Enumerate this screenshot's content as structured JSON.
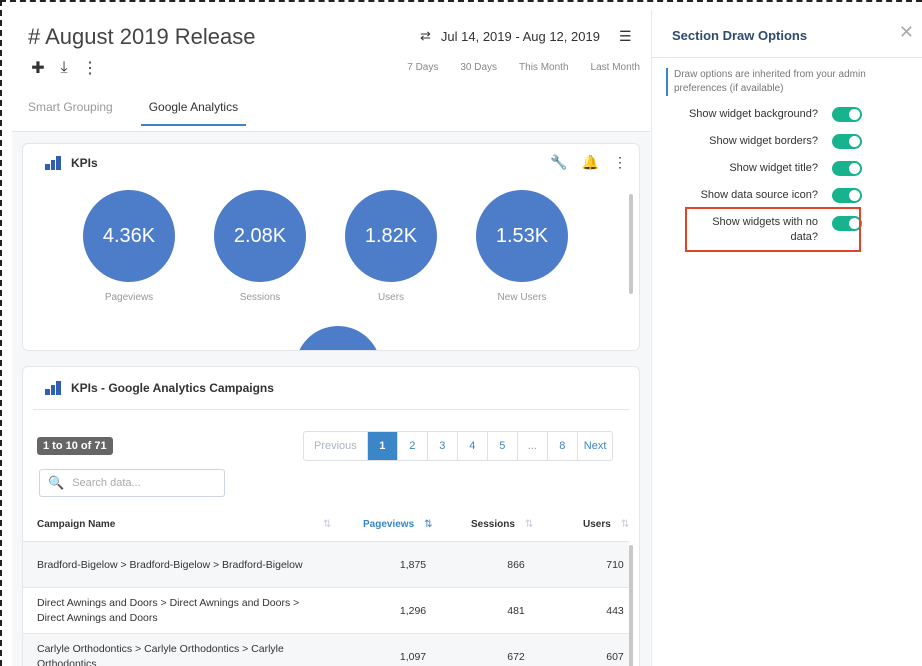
{
  "header": {
    "title": "# August 2019 Release",
    "date_range": "Jul 14, 2019 - Aug 12, 2019",
    "presets": [
      "7 Days",
      "30 Days",
      "This Month",
      "Last Month"
    ],
    "toolbar_icons": [
      "plus-icon",
      "download-icon",
      "more-vertical-icon"
    ]
  },
  "tabs": [
    {
      "label": "Smart Grouping",
      "active": false
    },
    {
      "label": "Google Analytics",
      "active": true
    }
  ],
  "kpi_card": {
    "title": "KPIs",
    "metrics": [
      {
        "value": "4.36K",
        "label": "Pageviews"
      },
      {
        "value": "2.08K",
        "label": "Sessions"
      },
      {
        "value": "1.82K",
        "label": "Users"
      },
      {
        "value": "1.53K",
        "label": "New Users"
      }
    ]
  },
  "campaign_card": {
    "title": "KPIs - Google Analytics Campaigns",
    "count": "1 to 10 of 71",
    "pager": [
      "Previous",
      "1",
      "2",
      "3",
      "4",
      "5",
      "...",
      "8",
      "Next"
    ],
    "search_placeholder": "Search data...",
    "columns": [
      "Campaign Name",
      "Pageviews",
      "Sessions",
      "Users"
    ],
    "rows": [
      {
        "name": "Bradford-Bigelow > Bradford-Bigelow > Bradford-Bigelow",
        "pageviews": "1,875",
        "sessions": "866",
        "users": "710"
      },
      {
        "name": "Direct Awnings and Doors > Direct Awnings and Doors > Direct Awnings and Doors",
        "pageviews": "1,296",
        "sessions": "481",
        "users": "443"
      },
      {
        "name": "Carlyle Orthodontics > Carlyle Orthodontics > Carlyle Orthodontics",
        "pageviews": "1,097",
        "sessions": "672",
        "users": "607"
      }
    ]
  },
  "side_panel": {
    "title": "Section Draw Options",
    "note": "Draw options are inherited from your admin preferences (if available)",
    "options": [
      {
        "label": "Show widget background?",
        "on": true
      },
      {
        "label": "Show widget borders?",
        "on": true
      },
      {
        "label": "Show widget title?",
        "on": true
      },
      {
        "label": "Show data source icon?",
        "on": true
      },
      {
        "label": "Show widgets with no data?",
        "on": true
      }
    ]
  },
  "colors": {
    "accent": "#3a86c8",
    "toggle": "#17b38f",
    "bubble": "#4d7cc8",
    "highlight": "#e0452b"
  }
}
